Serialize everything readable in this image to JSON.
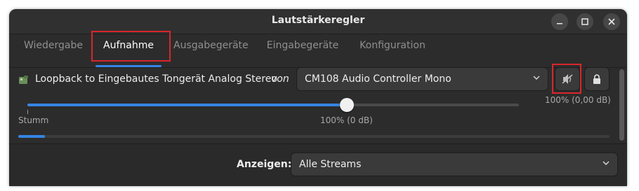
{
  "window": {
    "title": "Lautstärkeregler"
  },
  "tabs": [
    {
      "label": "Wiedergabe"
    },
    {
      "label": "Aufnahme"
    },
    {
      "label": "Ausgabegeräte"
    },
    {
      "label": "Eingabegeräte"
    },
    {
      "label": "Konfiguration"
    }
  ],
  "active_tab": "Aufnahme",
  "stream": {
    "name": "Loopback to Eingebautes Tongerät Analog Stereo",
    "von": "von",
    "device": "CM108 Audio Controller Mono",
    "volume_readout": "100% (0,00 dB)",
    "muted": true,
    "slider": {
      "min_label": "Stumm",
      "mark_label": "100% (0 dB)",
      "value_fraction": 0.65
    },
    "level_fraction": 0.045
  },
  "footer": {
    "label": "Anzeigen:",
    "value": "Alle Streams"
  },
  "colors": {
    "accent": "#3584e4",
    "highlight_box": "#d9262d",
    "background": "#2c2c2c"
  },
  "icons": [
    "minimize-icon",
    "maximize-icon",
    "close-icon",
    "app-icon",
    "chevron-down-icon",
    "mute-speaker-icon",
    "lock-icon"
  ]
}
